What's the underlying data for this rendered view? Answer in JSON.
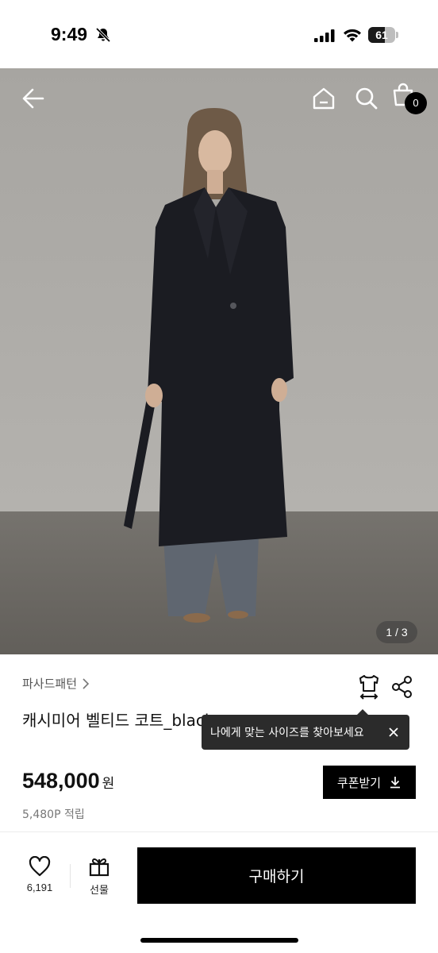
{
  "status_bar": {
    "time": "9:49",
    "battery_level": "61",
    "battery_fraction": 0.61,
    "icons": [
      "bell-slash-icon",
      "signal-icon",
      "wifi-icon",
      "battery-icon"
    ]
  },
  "hero": {
    "page_indicator": "1 / 3",
    "cart_count": "0",
    "icons": [
      "back-arrow-icon",
      "home-icon",
      "search-icon",
      "shopping-bag-icon"
    ]
  },
  "product": {
    "brand": "파사드패턴",
    "title": "캐시미어 벨티드 코트_black",
    "price": "548,000",
    "price_unit": "원",
    "points": "5,480P 적립",
    "coupon_label": "쿠폰받기"
  },
  "tooltip": {
    "text": "나에게 맞는 사이즈를 찾아보세요"
  },
  "bottom_bar": {
    "like_count": "6,191",
    "gift_label": "선물",
    "buy_label": "구매하기"
  },
  "colors": {
    "primary": "#000000",
    "tooltip_bg": "#2b2b2b",
    "muted_text": "#777777"
  }
}
